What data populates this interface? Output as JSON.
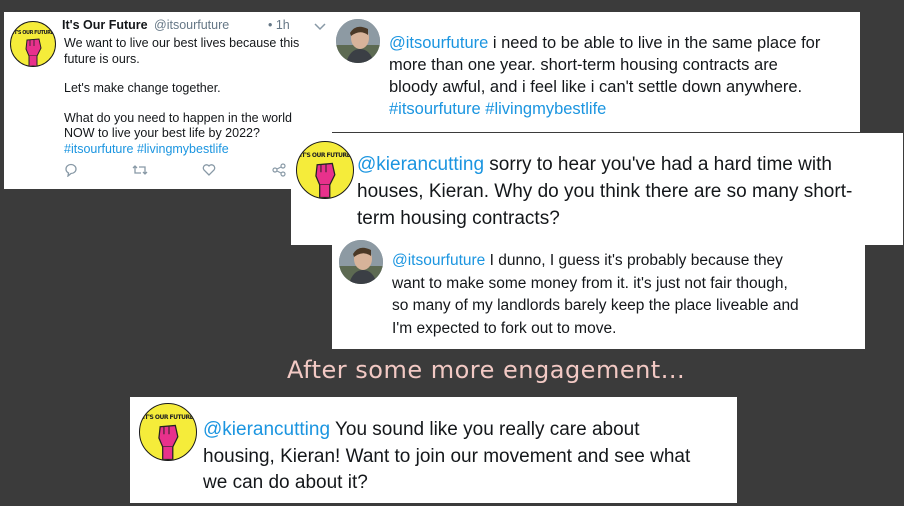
{
  "tweet1": {
    "name": "It's Our Future",
    "handle": "@itsourfuture",
    "time": "• 1h",
    "line1": "We want to live our best lives because this",
    "line2": "future is ours.",
    "line3": "Let's make change together.",
    "line4": "What do you need to happen in the world",
    "line5": "NOW to live your best life by 2022?",
    "hashtags": "#itsourfuture #livingmybestlife",
    "logo_text": "IT'S OUR FUTURE"
  },
  "reply1": {
    "mention": "@itsourfuture",
    "line1": " i need to be able to live in the same place for",
    "line2": "more than one year. short-term housing contracts are",
    "line3": "bloody awful, and i feel like i can't settle down anywhere.",
    "hashtags": "#itsourfuture #livingmybestlife"
  },
  "reply2": {
    "mention": "@kierancutting",
    "line1": " sorry to hear you've had a hard time with",
    "line2": "houses, Kieran. Why do you think there are so many short-",
    "line3": "term housing contracts?"
  },
  "reply3": {
    "mention": "@itsourfuture",
    "line1": " I dunno, I guess it's probably because they",
    "line2": "want to make some money from it. it's just not fair though,",
    "line3": "so many of my landlords barely keep the place liveable and",
    "line4": "I'm expected to fork out to move."
  },
  "caption": "After some more engagement...",
  "reply4": {
    "mention": "@kierancutting",
    "line1": " You sound like you really care about",
    "line2": "housing, Kieran! Want to join our movement and see what",
    "line3": "we can do about it?"
  },
  "colors": {
    "background": "#3b3b3b",
    "link": "#1b95e0",
    "caption": "#f2c9c4",
    "logo_yellow": "#f5ec3a",
    "logo_pink": "#e8318c"
  },
  "icons": [
    "reply-icon",
    "retweet-icon",
    "like-icon",
    "share-icon",
    "chevron-down-icon"
  ]
}
